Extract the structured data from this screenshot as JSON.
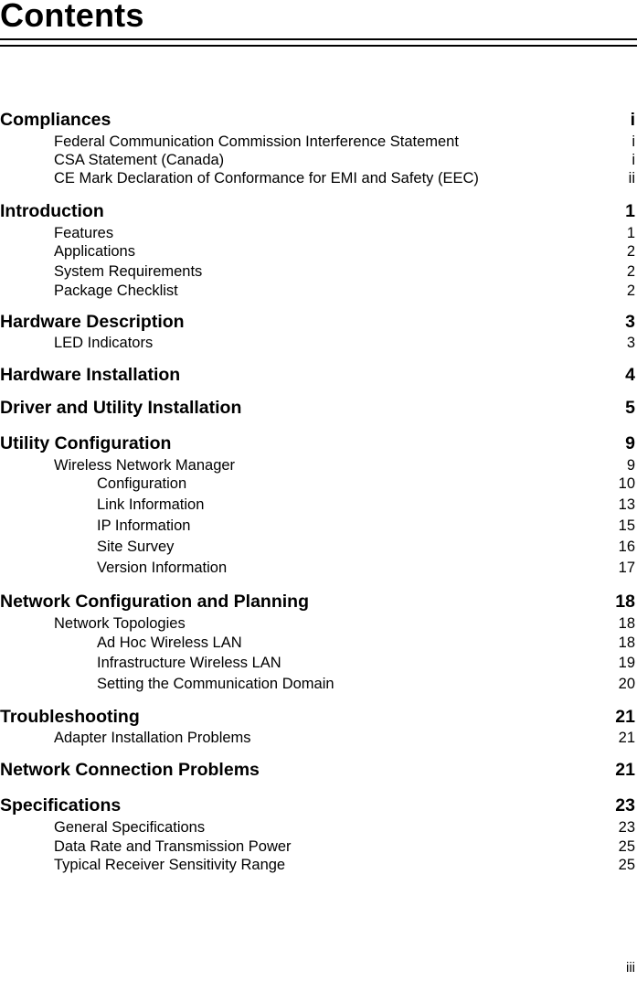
{
  "header": {
    "title": "Contents"
  },
  "toc": [
    {
      "level": 0,
      "label": "Compliances",
      "page": "i"
    },
    {
      "level": 1,
      "label": "Federal Communication Commission Interference Statement",
      "page": "i"
    },
    {
      "level": 1,
      "label": "CSA Statement (Canada)",
      "page": "i"
    },
    {
      "level": 1,
      "label": "CE Mark Declaration of Conformance for EMI and Safety (EEC)",
      "page": "ii"
    },
    {
      "level": 0,
      "label": "Introduction",
      "page": "1"
    },
    {
      "level": 1,
      "label": "Features",
      "page": "1"
    },
    {
      "level": 1,
      "label": "Applications",
      "page": "2"
    },
    {
      "level": 1,
      "label": "System Requirements",
      "page": "2"
    },
    {
      "level": 1,
      "label": "Package Checklist",
      "page": "2"
    },
    {
      "level": 0,
      "label": "Hardware Description",
      "page": "3"
    },
    {
      "level": 1,
      "label": "LED Indicators",
      "page": "3"
    },
    {
      "level": 0,
      "label": "Hardware Installation",
      "page": "4"
    },
    {
      "level": 0,
      "label": "Driver and Utility Installation",
      "page": "5"
    },
    {
      "level": 0,
      "label": "Utility Configuration",
      "page": "9"
    },
    {
      "level": 1,
      "label": "Wireless Network Manager",
      "page": "9"
    },
    {
      "level": 2,
      "label": "Configuration",
      "page": "10"
    },
    {
      "level": 2,
      "label": "Link Information",
      "page": "13"
    },
    {
      "level": 2,
      "label": "IP Information",
      "page": "15"
    },
    {
      "level": 2,
      "label": "Site Survey",
      "page": "16"
    },
    {
      "level": 2,
      "label": "Version Information",
      "page": "17"
    },
    {
      "level": 0,
      "label": "Network Configuration and Planning",
      "page": "18"
    },
    {
      "level": 1,
      "label": "Network Topologies",
      "page": "18"
    },
    {
      "level": 2,
      "label": "Ad Hoc Wireless LAN",
      "page": "18"
    },
    {
      "level": 2,
      "label": "Infrastructure Wireless LAN",
      "page": "19"
    },
    {
      "level": 2,
      "label": "Setting the Communication Domain",
      "page": "20"
    },
    {
      "level": 0,
      "label": "Troubleshooting",
      "page": "21"
    },
    {
      "level": 1,
      "label": "Adapter Installation Problems",
      "page": "21"
    },
    {
      "level": 0,
      "label": "Network Connection Problems",
      "page": "21"
    },
    {
      "level": 0,
      "label": "Specifications",
      "page": "23"
    },
    {
      "level": 1,
      "label": "General Specifications",
      "page": "23"
    },
    {
      "level": 1,
      "label": "Data Rate and Transmission Power",
      "page": "25"
    },
    {
      "level": 1,
      "label": "Typical Receiver Sensitivity Range",
      "page": "25"
    }
  ],
  "footer": {
    "page_number": "iii"
  }
}
